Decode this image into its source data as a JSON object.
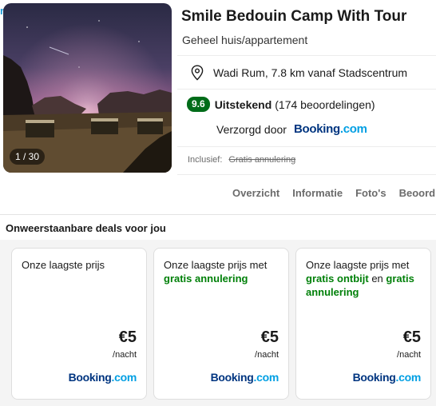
{
  "header": {
    "title": "Smile Bedouin Camp With Tour",
    "property_type": "Geheel huis/appartement"
  },
  "gallery": {
    "counter": "1 / 30"
  },
  "location": {
    "icon": "map-pin-icon",
    "text": "Wadi Rum, 7.8 km vanaf Stadscentrum"
  },
  "rating": {
    "score": "9.6",
    "label": "Uitstekend",
    "count": "(174 beoordelingen)",
    "badge_color": "#006c19"
  },
  "provider": {
    "label": "Verzorgd door",
    "logo": {
      "main": "Booking",
      "suffix": ".com"
    }
  },
  "included": {
    "label": "Inclusief:",
    "value": "Gratis annulering"
  },
  "tabs": [
    {
      "label": "Overzicht"
    },
    {
      "label": "Informatie"
    },
    {
      "label": "Foto's"
    },
    {
      "label": "Beoord"
    }
  ],
  "deals": {
    "title": "Onweerstaanbare deals voor jou",
    "cards": [
      {
        "parts": [
          {
            "text": "Onze laagste prijs",
            "highlight": false
          }
        ],
        "price": "€5",
        "unit": "/nacht",
        "logo": {
          "main": "Booking",
          "suffix": ".com"
        }
      },
      {
        "parts": [
          {
            "text": "Onze laagste prijs met ",
            "highlight": false
          },
          {
            "text": "gratis annulering",
            "highlight": true
          }
        ],
        "price": "€5",
        "unit": "/nacht",
        "logo": {
          "main": "Booking",
          "suffix": ".com"
        }
      },
      {
        "parts": [
          {
            "text": "Onze laagste prijs met ",
            "highlight": false
          },
          {
            "text": "gratis ontbijt",
            "highlight": true
          },
          {
            "text": " en ",
            "highlight": false
          },
          {
            "text": "gratis annulering",
            "highlight": true
          }
        ],
        "price": "€5",
        "unit": "/nacht",
        "logo": {
          "main": "Booking",
          "suffix": ".com"
        }
      }
    ]
  },
  "colors": {
    "highlight_green": "#008009",
    "booking_dark": "#003580",
    "booking_light": "#009fe3"
  }
}
